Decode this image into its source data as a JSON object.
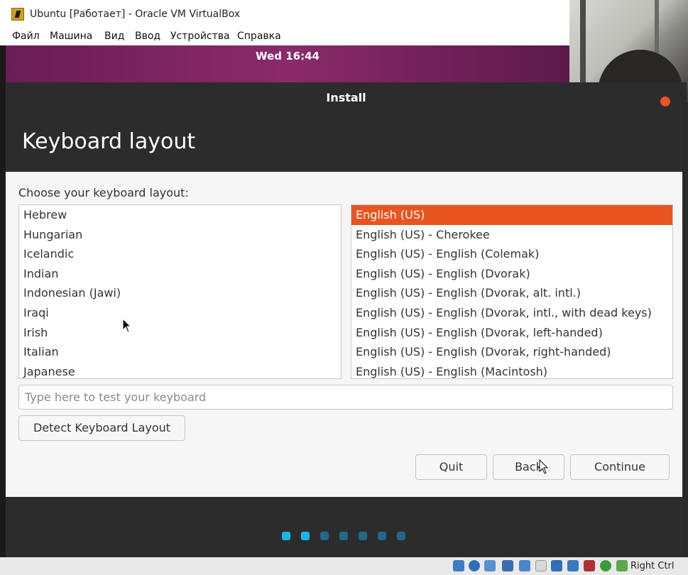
{
  "window": {
    "title": "Ubuntu [Работает] - Oracle VM VirtualBox",
    "menu": [
      "Файл",
      "Машина",
      "Вид",
      "Ввод",
      "Устройства",
      "Справка"
    ]
  },
  "vm": {
    "clock": "Wed 16:44"
  },
  "installer": {
    "dialog_title": "Install",
    "heading": "Keyboard layout",
    "choose_label": "Choose your keyboard layout:",
    "layouts": [
      "Hebrew",
      "Hungarian",
      "Icelandic",
      "Indian",
      "Indonesian (Jawi)",
      "Iraqi",
      "Irish",
      "Italian",
      "Japanese"
    ],
    "variants": [
      "English (US)",
      "English (US) - Cherokee",
      "English (US) - English (Colemak)",
      "English (US) - English (Dvorak)",
      "English (US) - English (Dvorak, alt. intl.)",
      "English (US) - English (Dvorak, intl., with dead keys)",
      "English (US) - English (Dvorak, left-handed)",
      "English (US) - English (Dvorak, right-handed)",
      "English (US) - English (Macintosh)"
    ],
    "selected_variant": "English (US)",
    "test_placeholder": "Type here to test your keyboard",
    "test_value": "",
    "detect_label": "Detect Keyboard Layout",
    "quit_label": "Quit",
    "back_label": "Back",
    "continue_label": "Continue",
    "progress": {
      "total_steps": 7,
      "current_step": 2
    }
  },
  "statusbar": {
    "host_key": "Right Ctrl",
    "icons": [
      "hard-disk-icon",
      "optical-drive-icon",
      "audio-icon",
      "network-icon",
      "usb-icon",
      "shared-folder-icon",
      "display-icon",
      "video-capture-icon",
      "cpu-icon",
      "guest-additions-icon",
      "mouse-integration-icon"
    ]
  }
}
